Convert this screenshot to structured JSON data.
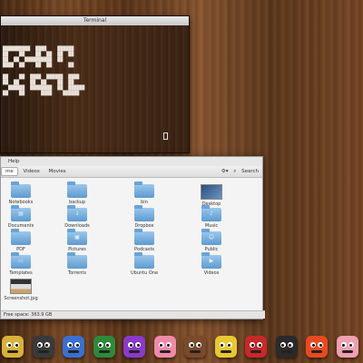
{
  "terminal": {
    "title": "Terminal",
    "art": "\n\n\n██████████  ████    ██████\n██    ██    ██  ██  ██  ██\n██  ██  ██████████  ██\n████  ██    ██  ██      ██\n\n██    ██  ████  ██████  ████\n██  ██    ██  ██    ██  ██\n  ██████  ████████  ██  ██████\n██    ██      ████    ██████"
  },
  "files": {
    "menu": "Help",
    "breadcrumbs": [
      "me",
      "Videos",
      "Movies"
    ],
    "search_label": "Search",
    "items": [
      {
        "label": "Notebooks",
        "icon": "folder-icon"
      },
      {
        "label": "backup",
        "icon": "folder-icon"
      },
      {
        "label": "bin",
        "icon": "folder-icon"
      },
      {
        "label": "Desktop",
        "icon": "desktop-icon"
      },
      {
        "label": "Documents",
        "icon": "folder-documents-icon"
      },
      {
        "label": "Downloads",
        "icon": "folder-downloads-icon"
      },
      {
        "label": "Dropbox",
        "icon": "folder-icon"
      },
      {
        "label": "Music",
        "icon": "folder-music-icon"
      },
      {
        "label": "PDF",
        "icon": "folder-icon"
      },
      {
        "label": "Pictures",
        "icon": "folder-pictures-icon"
      },
      {
        "label": "Podcasts",
        "icon": "folder-icon"
      },
      {
        "label": "Public",
        "icon": "folder-public-icon"
      },
      {
        "label": "Templates",
        "icon": "folder-templates-icon"
      },
      {
        "label": "Torrents",
        "icon": "folder-icon"
      },
      {
        "label": "Ubuntu One",
        "icon": "folder-icon"
      },
      {
        "label": "Videos",
        "icon": "folder-videos-icon"
      },
      {
        "label": "Screenshot.jpg",
        "icon": "image-file-icon"
      }
    ],
    "status": "Free space: 363.9 GB"
  },
  "dock": {
    "icons": [
      {
        "name": "dock-monster-1",
        "color": "#d8b23a"
      },
      {
        "name": "dock-monster-2",
        "color": "#3a3a3a"
      },
      {
        "name": "dock-monster-3",
        "color": "#3b6fd0"
      },
      {
        "name": "dock-monster-4",
        "color": "#2e8a3a"
      },
      {
        "name": "dock-monster-5",
        "color": "#8a3ac8"
      },
      {
        "name": "dock-monster-6",
        "color": "#f08aa8"
      },
      {
        "name": "dock-monster-7",
        "color": "#7a4a2a"
      },
      {
        "name": "dock-monster-8",
        "color": "#e8c830"
      },
      {
        "name": "dock-monster-9",
        "color": "#c82828"
      },
      {
        "name": "dock-monster-10",
        "color": "#2a2a2a"
      },
      {
        "name": "dock-monster-11",
        "color": "#e84a20"
      },
      {
        "name": "dock-monster-12",
        "color": "#f0a0b0"
      }
    ]
  }
}
